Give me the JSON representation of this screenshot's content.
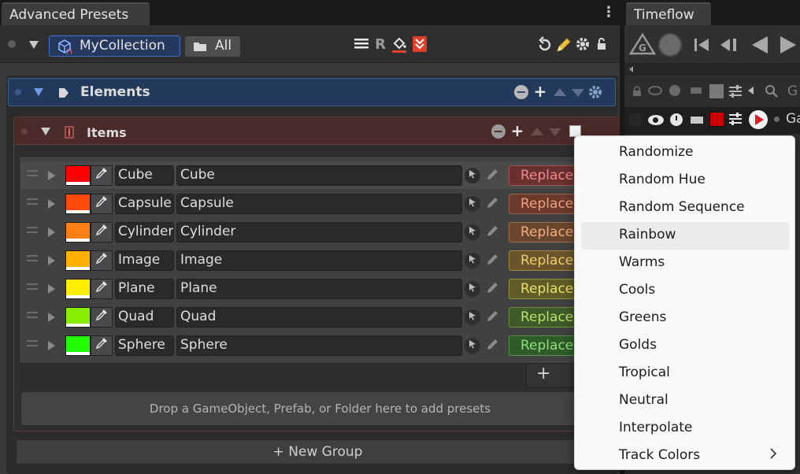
{
  "tabs": {
    "advanced_presets": "Advanced Presets",
    "timeflow": "Timeflow"
  },
  "toolbar": {
    "collection_name": "MyCollection",
    "filter_label": "All",
    "reset_label": "R"
  },
  "elements": {
    "title": "Elements"
  },
  "items": {
    "title": "Items",
    "rows": [
      {
        "short": "Cube",
        "name": "Cube",
        "color": "#ff0000",
        "replace": "Replace",
        "btn_bg": "#6a2f2f",
        "btn_fg": "#f08a8a"
      },
      {
        "short": "Capsule",
        "name": "Capsule",
        "color": "#ff4a0c",
        "replace": "Replace",
        "btn_bg": "#6a3a2c",
        "btn_fg": "#f0a07e"
      },
      {
        "short": "Cylinder",
        "name": "Cylinder",
        "color": "#ff7f12",
        "replace": "Replace",
        "btn_bg": "#6a4630",
        "btn_fg": "#f0b07a"
      },
      {
        "short": "Image",
        "name": "Image",
        "color": "#ffb000",
        "replace": "Replace",
        "btn_bg": "#6a552a",
        "btn_fg": "#f0cc72"
      },
      {
        "short": "Plane",
        "name": "Plane",
        "color": "#ffee00",
        "replace": "Replace",
        "btn_bg": "#5f5c28",
        "btn_fg": "#e8e06a"
      },
      {
        "short": "Quad",
        "name": "Quad",
        "color": "#88ee00",
        "replace": "Replace",
        "btn_bg": "#3f5a28",
        "btn_fg": "#b8e06a"
      },
      {
        "short": "Sphere",
        "name": "Sphere",
        "color": "#22ff00",
        "replace": "Replace",
        "btn_bg": "#2f5a2a",
        "btn_fg": "#8ee07a"
      }
    ],
    "drop_hint": "Drop a GameObject, Prefab, or Folder here to add presets",
    "add_symbol": "+",
    "new_group": "+ New Group"
  },
  "timeflow": {
    "row_label": "Ga",
    "search_label": "G"
  },
  "menu": {
    "items": [
      "Randomize",
      "Random Hue",
      "Random Sequence",
      "Rainbow",
      "Warms",
      "Cools",
      "Greens",
      "Golds",
      "Tropical",
      "Neutral",
      "Interpolate",
      "Track Colors"
    ],
    "highlighted_index": 3,
    "submenu_index": 11
  }
}
